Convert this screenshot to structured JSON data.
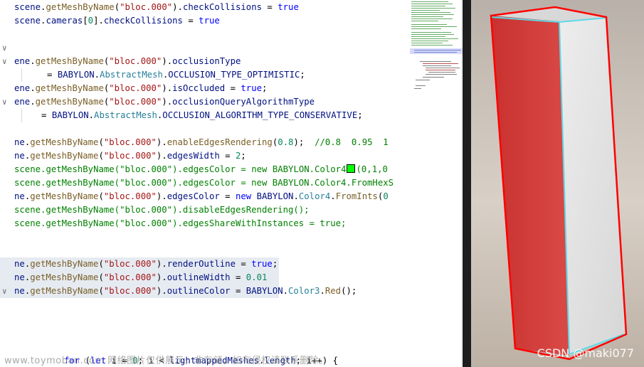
{
  "editor": {
    "lines": [
      {
        "fold": false,
        "indent": 20,
        "highlight": false,
        "tokens": [
          {
            "t": "scene",
            "c": "c-var"
          },
          {
            "t": ".",
            "c": "c-txt"
          },
          {
            "t": "getMeshByName",
            "c": "c-fn"
          },
          {
            "t": "(",
            "c": "c-txt"
          },
          {
            "t": "\"bloc.000\"",
            "c": "c-str"
          },
          {
            "t": ").",
            "c": "c-txt"
          },
          {
            "t": "checkCollisions",
            "c": "c-var"
          },
          {
            "t": " = ",
            "c": "c-txt"
          },
          {
            "t": "true",
            "c": "c-kw"
          }
        ]
      },
      {
        "fold": false,
        "indent": 20,
        "highlight": false,
        "tokens": [
          {
            "t": "scene",
            "c": "c-var"
          },
          {
            "t": ".",
            "c": "c-txt"
          },
          {
            "t": "cameras",
            "c": "c-var"
          },
          {
            "t": "[",
            "c": "c-txt"
          },
          {
            "t": "0",
            "c": "c-num"
          },
          {
            "t": "].",
            "c": "c-txt"
          },
          {
            "t": "checkCollisions",
            "c": "c-var"
          },
          {
            "t": " = ",
            "c": "c-txt"
          },
          {
            "t": "true",
            "c": "c-kw"
          }
        ]
      },
      {
        "fold": false,
        "indent": 20,
        "highlight": false,
        "tokens": []
      },
      {
        "fold": true,
        "indent": 20,
        "highlight": false,
        "tokens": []
      },
      {
        "fold": true,
        "indent": 20,
        "highlight": false,
        "tokens": [
          {
            "t": "ene",
            "c": "c-var"
          },
          {
            "t": ".",
            "c": "c-txt"
          },
          {
            "t": "getMeshByName",
            "c": "c-fn"
          },
          {
            "t": "(",
            "c": "c-txt"
          },
          {
            "t": "\"bloc.000\"",
            "c": "c-str"
          },
          {
            "t": ").",
            "c": "c-txt"
          },
          {
            "t": "occlusionType",
            "c": "c-var"
          }
        ]
      },
      {
        "fold": false,
        "indent": 66,
        "highlight": false,
        "tokens": [
          {
            "t": "= ",
            "c": "c-txt"
          },
          {
            "t": "BABYLON",
            "c": "c-var"
          },
          {
            "t": ".",
            "c": "c-txt"
          },
          {
            "t": "AbstractMesh",
            "c": "c-cls"
          },
          {
            "t": ".",
            "c": "c-txt"
          },
          {
            "t": "OCCLUSION_TYPE_OPTIMISTIC",
            "c": "c-var"
          },
          {
            "t": ";",
            "c": "c-txt"
          }
        ]
      },
      {
        "fold": false,
        "indent": 20,
        "highlight": false,
        "tokens": [
          {
            "t": "ene",
            "c": "c-var"
          },
          {
            "t": ".",
            "c": "c-txt"
          },
          {
            "t": "getMeshByName",
            "c": "c-fn"
          },
          {
            "t": "(",
            "c": "c-txt"
          },
          {
            "t": "\"bloc.000\"",
            "c": "c-str"
          },
          {
            "t": ").",
            "c": "c-txt"
          },
          {
            "t": "isOccluded",
            "c": "c-var"
          },
          {
            "t": " = ",
            "c": "c-txt"
          },
          {
            "t": "true",
            "c": "c-kw"
          },
          {
            "t": ";",
            "c": "c-txt"
          }
        ]
      },
      {
        "fold": true,
        "indent": 20,
        "highlight": false,
        "tokens": [
          {
            "t": "ene",
            "c": "c-var"
          },
          {
            "t": ".",
            "c": "c-txt"
          },
          {
            "t": "getMeshByName",
            "c": "c-fn"
          },
          {
            "t": "(",
            "c": "c-txt"
          },
          {
            "t": "\"bloc.000\"",
            "c": "c-str"
          },
          {
            "t": ").",
            "c": "c-txt"
          },
          {
            "t": "occlusionQueryAlgorithmType",
            "c": "c-var"
          }
        ]
      },
      {
        "fold": false,
        "indent": 58,
        "highlight": false,
        "tokens": [
          {
            "t": "= ",
            "c": "c-txt"
          },
          {
            "t": "BABYLON",
            "c": "c-var"
          },
          {
            "t": ".",
            "c": "c-txt"
          },
          {
            "t": "AbstractMesh",
            "c": "c-cls"
          },
          {
            "t": ".",
            "c": "c-txt"
          },
          {
            "t": "OCCLUSION_ALGORITHM_TYPE_CONSERVATIVE",
            "c": "c-var"
          },
          {
            "t": ";",
            "c": "c-txt"
          }
        ]
      },
      {
        "fold": false,
        "indent": 20,
        "highlight": false,
        "tokens": []
      },
      {
        "fold": false,
        "indent": 20,
        "highlight": false,
        "tokens": [
          {
            "t": "ne",
            "c": "c-var"
          },
          {
            "t": ".",
            "c": "c-txt"
          },
          {
            "t": "getMeshByName",
            "c": "c-fn"
          },
          {
            "t": "(",
            "c": "c-txt"
          },
          {
            "t": "\"bloc.000\"",
            "c": "c-str"
          },
          {
            "t": ").",
            "c": "c-txt"
          },
          {
            "t": "enableEdgesRendering",
            "c": "c-fn"
          },
          {
            "t": "(",
            "c": "c-txt"
          },
          {
            "t": "0.8",
            "c": "c-num"
          },
          {
            "t": ");  ",
            "c": "c-txt"
          },
          {
            "t": "//0.8  0.95  1",
            "c": "c-cmt"
          }
        ]
      },
      {
        "fold": false,
        "indent": 20,
        "highlight": false,
        "tokens": [
          {
            "t": "ne",
            "c": "c-var"
          },
          {
            "t": ".",
            "c": "c-txt"
          },
          {
            "t": "getMeshByName",
            "c": "c-fn"
          },
          {
            "t": "(",
            "c": "c-txt"
          },
          {
            "t": "\"bloc.000\"",
            "c": "c-str"
          },
          {
            "t": ").",
            "c": "c-txt"
          },
          {
            "t": "edgesWidth",
            "c": "c-var"
          },
          {
            "t": " = ",
            "c": "c-txt"
          },
          {
            "t": "2",
            "c": "c-num"
          },
          {
            "t": ";",
            "c": "c-txt"
          }
        ]
      },
      {
        "fold": false,
        "indent": 20,
        "highlight": false,
        "swatch_after": 8,
        "tokens": [
          {
            "t": "scene",
            "c": "c-cmt"
          },
          {
            "t": ".",
            "c": "c-cmt"
          },
          {
            "t": "getMeshByName",
            "c": "c-cmt"
          },
          {
            "t": "(",
            "c": "c-cmt"
          },
          {
            "t": "\"bloc.000\"",
            "c": "c-cmt"
          },
          {
            "t": ").",
            "c": "c-cmt"
          },
          {
            "t": "edgesColor",
            "c": "c-cmt"
          },
          {
            "t": " = new ",
            "c": "c-cmt"
          },
          {
            "t": "BABYLON.Color4",
            "c": "c-cmt"
          },
          {
            "t": "(0,1,0",
            "c": "c-cmt"
          }
        ]
      },
      {
        "fold": false,
        "indent": 20,
        "highlight": false,
        "tokens": [
          {
            "t": "scene.getMeshByName(\"bloc.000\").edgesColor = new BABYLON.Color4.FromHexS",
            "c": "c-cmt"
          }
        ]
      },
      {
        "fold": false,
        "indent": 20,
        "highlight": false,
        "tokens": [
          {
            "t": "ne",
            "c": "c-var"
          },
          {
            "t": ".",
            "c": "c-txt"
          },
          {
            "t": "getMeshByName",
            "c": "c-fn"
          },
          {
            "t": "(",
            "c": "c-txt"
          },
          {
            "t": "\"bloc.000\"",
            "c": "c-str"
          },
          {
            "t": ").",
            "c": "c-txt"
          },
          {
            "t": "edgesColor",
            "c": "c-var"
          },
          {
            "t": " = ",
            "c": "c-txt"
          },
          {
            "t": "new",
            "c": "c-kw"
          },
          {
            "t": " ",
            "c": "c-txt"
          },
          {
            "t": "BABYLON",
            "c": "c-var"
          },
          {
            "t": ".",
            "c": "c-txt"
          },
          {
            "t": "Color4",
            "c": "c-cls"
          },
          {
            "t": ".",
            "c": "c-txt"
          },
          {
            "t": "FromInts",
            "c": "c-fn"
          },
          {
            "t": "(",
            "c": "c-txt"
          },
          {
            "t": "0",
            "c": "c-num"
          }
        ]
      },
      {
        "fold": false,
        "indent": 20,
        "highlight": false,
        "tokens": [
          {
            "t": "scene.getMeshByName(\"bloc.000\").disableEdgesRendering();",
            "c": "c-cmt"
          }
        ]
      },
      {
        "fold": false,
        "indent": 20,
        "highlight": false,
        "tokens": [
          {
            "t": "scene.getMeshByName(\"bloc.000\").edgesShareWithInstances = true;",
            "c": "c-cmt"
          }
        ]
      },
      {
        "fold": false,
        "indent": 20,
        "highlight": false,
        "tokens": []
      },
      {
        "fold": false,
        "indent": 20,
        "highlight": false,
        "tokens": []
      },
      {
        "fold": false,
        "indent": 20,
        "highlight": true,
        "tokens": [
          {
            "t": "ne",
            "c": "c-var"
          },
          {
            "t": ".",
            "c": "c-txt"
          },
          {
            "t": "getMeshByName",
            "c": "c-fn"
          },
          {
            "t": "(",
            "c": "c-txt"
          },
          {
            "t": "\"bloc.000\"",
            "c": "c-str"
          },
          {
            "t": ").",
            "c": "c-txt"
          },
          {
            "t": "renderOutline",
            "c": "c-var"
          },
          {
            "t": " = ",
            "c": "c-txt"
          },
          {
            "t": "true",
            "c": "c-kw"
          },
          {
            "t": ";",
            "c": "c-txt"
          }
        ]
      },
      {
        "fold": false,
        "indent": 20,
        "highlight": true,
        "tokens": [
          {
            "t": "ne",
            "c": "c-var"
          },
          {
            "t": ".",
            "c": "c-txt"
          },
          {
            "t": "getMeshByName",
            "c": "c-fn"
          },
          {
            "t": "(",
            "c": "c-txt"
          },
          {
            "t": "\"bloc.000\"",
            "c": "c-str"
          },
          {
            "t": ").",
            "c": "c-txt"
          },
          {
            "t": "outlineWidth",
            "c": "c-var"
          },
          {
            "t": " = ",
            "c": "c-txt"
          },
          {
            "t": "0.01",
            "c": "c-num"
          }
        ]
      },
      {
        "fold": true,
        "indent": 20,
        "highlight": true,
        "tokens": [
          {
            "t": "ne",
            "c": "c-var"
          },
          {
            "t": ".",
            "c": "c-txt"
          },
          {
            "t": "getMeshByName",
            "c": "c-fn"
          },
          {
            "t": "(",
            "c": "c-txt"
          },
          {
            "t": "\"bloc.000\"",
            "c": "c-str"
          },
          {
            "t": ").",
            "c": "c-txt"
          },
          {
            "t": "outlineColor",
            "c": "c-var"
          },
          {
            "t": " = ",
            "c": "c-txt"
          },
          {
            "t": "BABYLON",
            "c": "c-var"
          },
          {
            "t": ".",
            "c": "c-txt"
          },
          {
            "t": "Color3",
            "c": "c-cls"
          },
          {
            "t": ".",
            "c": "c-txt"
          },
          {
            "t": "Red",
            "c": "c-fn"
          },
          {
            "t": "();",
            "c": "c-txt"
          }
        ]
      }
    ],
    "bottom_line": [
      {
        "t": "for",
        "c": "c-kw"
      },
      {
        "t": " (",
        "c": "c-txt"
      },
      {
        "t": "let",
        "c": "c-kw"
      },
      {
        "t": " i = ",
        "c": "c-txt"
      },
      {
        "t": "0",
        "c": "c-num"
      },
      {
        "t": "; i < ",
        "c": "c-txt"
      },
      {
        "t": "lightmappedMeshes",
        "c": "c-var"
      },
      {
        "t": ".",
        "c": "c-txt"
      },
      {
        "t": "length",
        "c": "c-var"
      },
      {
        "t": "; i++) {",
        "c": "c-txt"
      }
    ],
    "fold_glyph": "∨"
  },
  "watermarks": {
    "left": "www.toymoban.com 网络图片仅供展示，非存储，如有侵权请联系删除。",
    "right": "CSDN @maki077"
  },
  "colors": {
    "mesh_red": "#d23a3a",
    "outline_red": "#ff0000",
    "edge_cyan": "#5fd8e6",
    "mesh_white": "#e4e4e4"
  }
}
